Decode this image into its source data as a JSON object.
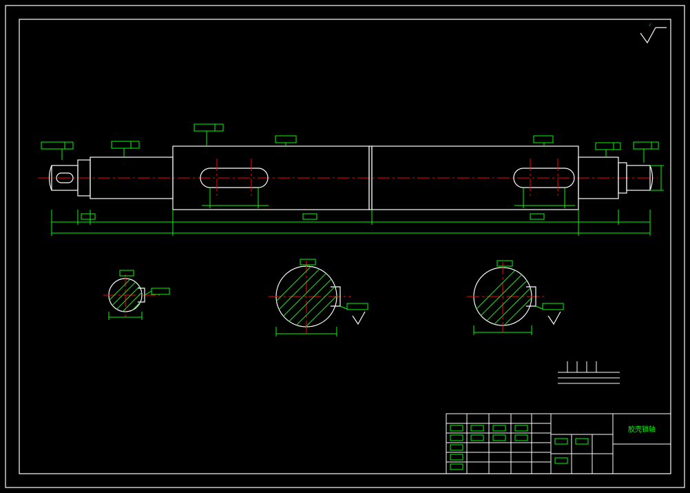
{
  "titleblock": {
    "title": "胶壳锁轴"
  },
  "surface_mark": "√",
  "sections": {
    "a": {
      "diameter_label": ""
    },
    "b": {
      "diameter_label": ""
    },
    "c": {
      "diameter_label": ""
    }
  }
}
